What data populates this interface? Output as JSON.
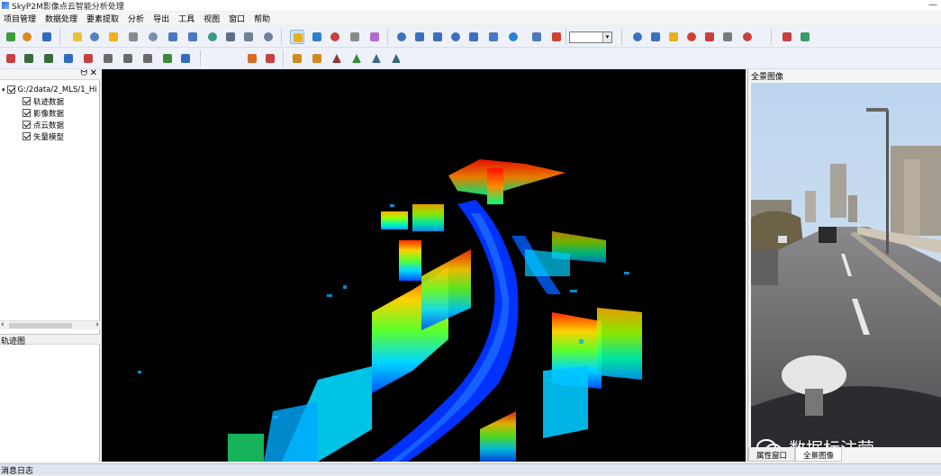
{
  "window": {
    "title": "SkyP2M影像点云智能分析处理",
    "controls": "—"
  },
  "menu": [
    "项目管理",
    "数据处理",
    "要素提取",
    "分析",
    "导出",
    "工具",
    "视图",
    "窗口",
    "帮助"
  ],
  "toolbar1": {
    "icons": [
      "new-icon",
      "open-icon",
      "save-icon",
      "rectangle-icon",
      "globe-icon",
      "bulb-icon",
      "grid-icon",
      "pan-hand-icon",
      "zoom-in-icon",
      "zoom-out-icon",
      "rotate-icon",
      "fit-icon",
      "layer-a-icon",
      "layer-b-icon",
      "select-icon",
      "measure-icon",
      "color-icon",
      "layers-icon",
      "palette-icon",
      "play-icon",
      "pause-icon",
      "stop-icon",
      "prev-icon",
      "next-icon",
      "insert-icon",
      "path-icon",
      "clock-icon",
      "location-pin-icon",
      "navigate-icon",
      "link-icon",
      "lightbulb-icon",
      "delete-icon",
      "bookmark-icon",
      "frame-icon",
      "print-icon",
      "export-icon",
      "settings-grid-icon"
    ],
    "dropdown_value": ""
  },
  "toolbar2": {
    "icons": [
      "vector-icon",
      "trend-icon",
      "trend-b-icon",
      "info-icon",
      "cancel-icon",
      "tag-icon",
      "eraser-icon",
      "camera-icon",
      "undo-icon",
      "redo-icon",
      "paint-icon",
      "brush-icon",
      "cross-icon",
      "cross-b-icon",
      "ramp-icon",
      "ramp-b-icon",
      "ramp-c-icon",
      "ramp-d-icon"
    ]
  },
  "left_panel": {
    "pin": "ᗢ",
    "close": "✕",
    "tree": {
      "root": "G:/2data/2_MLS/1_Hi",
      "children": [
        "轨迹数据",
        "影像数据",
        "点云数据",
        "矢量模型"
      ]
    },
    "track_title": "轨迹图"
  },
  "right_panel": {
    "title": "全景图像",
    "watermark": "数据标注营",
    "tabs": [
      "属性窗口",
      "全景图像"
    ]
  },
  "bottom": {
    "label": "消息日志"
  },
  "colors": {
    "toolbar_bg": "#eef2f8",
    "viewport_bg": "#000000",
    "selected_tool": "#cfe3f7"
  }
}
